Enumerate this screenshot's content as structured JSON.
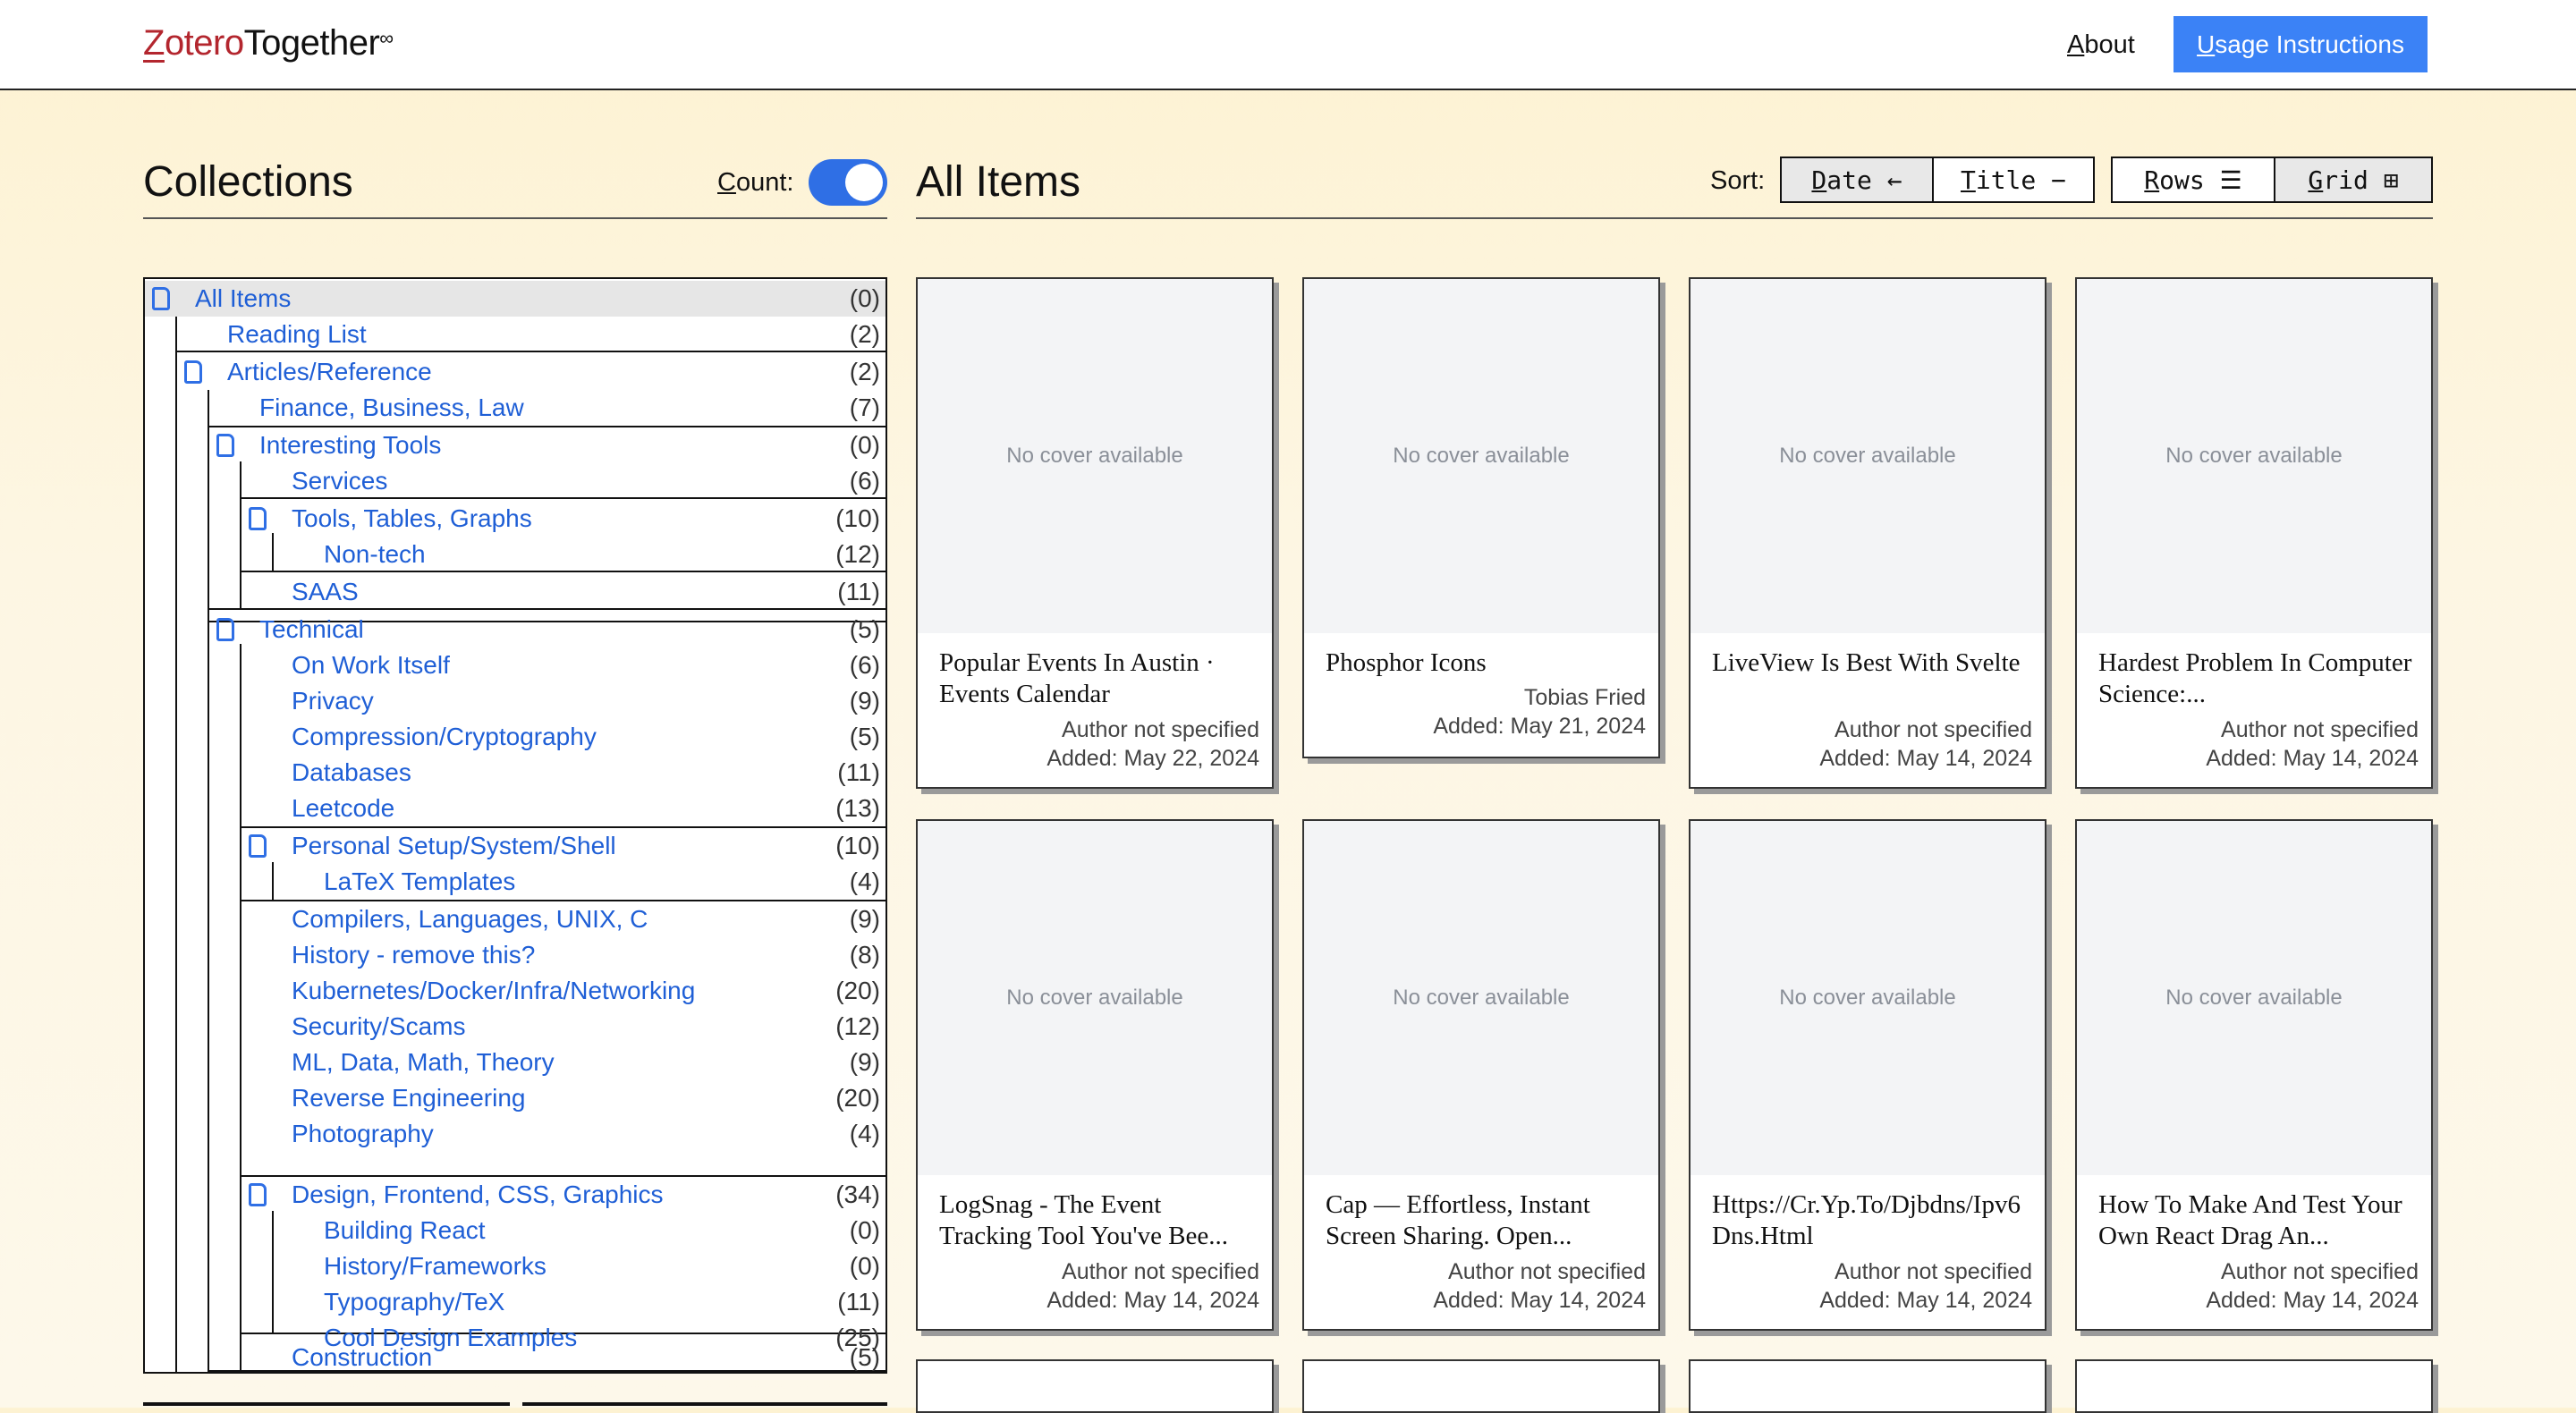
{
  "header": {
    "logo_prefix": "Z",
    "logo_rest": "otero",
    "logo_together": "Together",
    "logo_mark": "∞",
    "about_first": "A",
    "about_rest": "bout",
    "usage_first": "U",
    "usage_rest": "sage Instructions"
  },
  "collections": {
    "title": "Collections",
    "count_first": "C",
    "count_rest": "ount:",
    "count_enabled": true,
    "items": [
      {
        "label": "All Items",
        "count": "(0)",
        "selected": true
      },
      {
        "label": "Reading List",
        "count": "(2)"
      },
      {
        "label": "Articles/Reference",
        "count": "(2)"
      },
      {
        "label": "Finance, Business, Law",
        "count": "(7)"
      },
      {
        "label": "Interesting Tools",
        "count": "(0)"
      },
      {
        "label": "Services",
        "count": "(6)"
      },
      {
        "label": "Tools, Tables, Graphs",
        "count": "(10)"
      },
      {
        "label": "Non-tech",
        "count": "(12)"
      },
      {
        "label": "SAAS",
        "count": "(11)"
      },
      {
        "label": "Technical",
        "count": "(5)"
      },
      {
        "label": "On Work Itself",
        "count": "(6)"
      },
      {
        "label": "Privacy",
        "count": "(9)"
      },
      {
        "label": "Compression/Cryptography",
        "count": "(5)"
      },
      {
        "label": "Databases",
        "count": "(11)"
      },
      {
        "label": "Leetcode",
        "count": "(13)"
      },
      {
        "label": "Personal Setup/System/Shell",
        "count": "(10)"
      },
      {
        "label": "LaTeX Templates",
        "count": "(4)"
      },
      {
        "label": "Compilers, Languages, UNIX, C",
        "count": "(9)"
      },
      {
        "label": "History - remove this?",
        "count": "(8)"
      },
      {
        "label": "Kubernetes/Docker/Infra/Networking",
        "count": "(20)"
      },
      {
        "label": "Security/Scams",
        "count": "(12)"
      },
      {
        "label": "ML, Data, Math, Theory",
        "count": "(9)"
      },
      {
        "label": "Reverse Engineering",
        "count": "(20)"
      },
      {
        "label": "Photography",
        "count": "(4)"
      },
      {
        "label": "Design, Frontend, CSS, Graphics",
        "count": "(34)"
      },
      {
        "label": "Building React",
        "count": "(0)"
      },
      {
        "label": "History/Frameworks",
        "count": "(0)"
      },
      {
        "label": "Typography/TeX",
        "count": "(11)"
      },
      {
        "label": "Cool Design Examples",
        "count": "(25)"
      },
      {
        "label": "Construction",
        "count": "(5)"
      }
    ]
  },
  "items": {
    "title": "All Items",
    "sort_label": "Sort:",
    "sort_date_first": "D",
    "sort_date_rest": "ate ←",
    "sort_title_first": "T",
    "sort_title_rest": "itle −",
    "view_rows_first": "R",
    "view_rows_rest": "ows ☰",
    "view_grid_first": "G",
    "view_grid_rest": "rid ⊞",
    "no_cover": "No cover available",
    "cards": [
      {
        "title": "Popular Events In Austin · Events Calendar",
        "author": "Author not specified",
        "added": "Added: May 22, 2024"
      },
      {
        "title": "Phosphor Icons",
        "author": "Tobias Fried",
        "added": "Added: May 21, 2024"
      },
      {
        "title": "LiveView Is Best With Svelte",
        "author": "Author not specified",
        "added": "Added: May 14, 2024"
      },
      {
        "title": "Hardest Problem In Computer Science:...",
        "author": "Author not specified",
        "added": "Added: May 14, 2024"
      },
      {
        "title": "LogSnag - The Event Tracking Tool You've Bee...",
        "author": "Author not specified",
        "added": "Added: May 14, 2024"
      },
      {
        "title": "Cap — Effortless, Instant Screen Sharing. Open...",
        "author": "Author not specified",
        "added": "Added: May 14, 2024"
      },
      {
        "title": "Https://Cr.Yp.To/Djbdns/Ipv6 Dns.Html",
        "author": "Author not specified",
        "added": "Added: May 14, 2024"
      },
      {
        "title": "How To Make And Test Your Own React Drag An...",
        "author": "Author not specified",
        "added": "Added: May 14, 2024"
      }
    ]
  },
  "colors": {
    "accent": "#3b82f6",
    "link": "#1f5fd6",
    "logo_red": "#b3262e",
    "background": "#fdf4dc"
  }
}
